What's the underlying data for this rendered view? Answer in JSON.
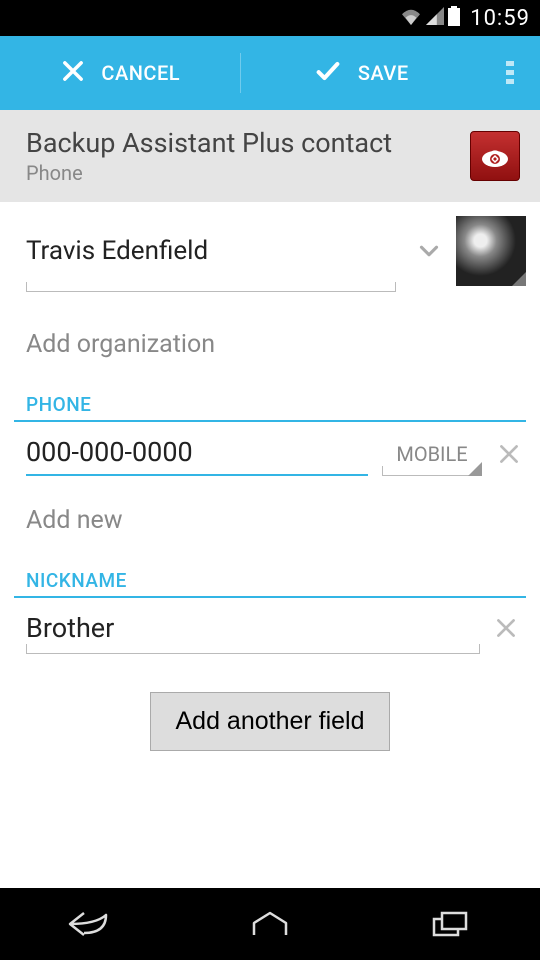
{
  "status": {
    "time": "10:59"
  },
  "actionbar": {
    "cancel": "CANCEL",
    "save": "SAVE"
  },
  "account": {
    "title": "Backup Assistant Plus contact",
    "subtitle": "Phone"
  },
  "name": {
    "value": "Travis Edenfield"
  },
  "organization": {
    "placeholder": "Add organization"
  },
  "sections": {
    "phone": {
      "label": "PHONE",
      "value": "000-000-0000",
      "type": "MOBILE",
      "add_new": "Add new"
    },
    "nickname": {
      "label": "NICKNAME",
      "value": "Brother"
    }
  },
  "add_field_label": "Add another field",
  "colors": {
    "accent": "#33b5e5"
  }
}
